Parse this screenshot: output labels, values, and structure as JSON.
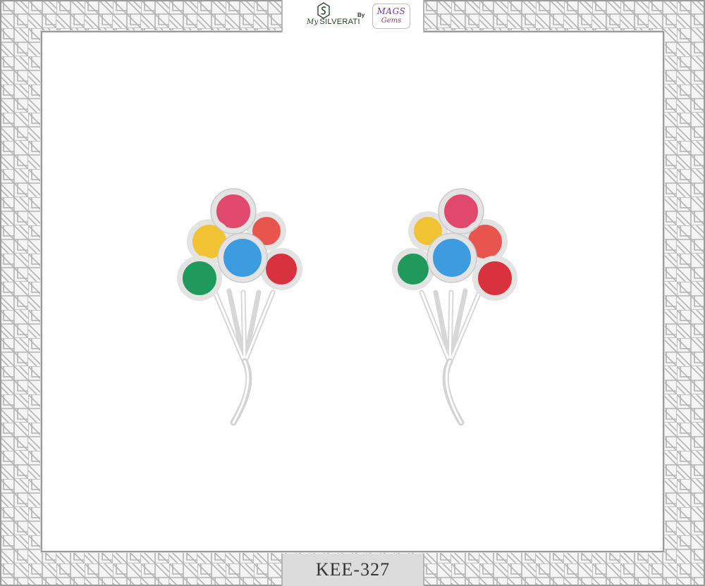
{
  "brand": {
    "maker": "SILVERATI",
    "maker_prefix": "My",
    "by": "By",
    "partner_line1": "MAGS",
    "partner_line2": "Gems"
  },
  "product": {
    "code": "KEE-327"
  },
  "colors": {
    "frame_stroke": "#b9b9b9",
    "panel": "#ffffff",
    "silver": "#e6e6e6",
    "balloon_pink": "#e0486e",
    "balloon_coral": "#e8554f",
    "balloon_yellow": "#f1c232",
    "balloon_blue": "#3d9be0",
    "balloon_red": "#d9323f",
    "balloon_green": "#1f9a5c"
  }
}
